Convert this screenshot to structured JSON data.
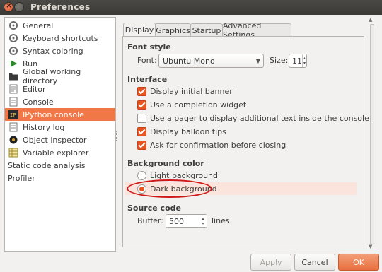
{
  "window": {
    "title": "Preferences"
  },
  "sidebar": {
    "items": [
      {
        "label": "General",
        "icon": "wrench-icon"
      },
      {
        "label": "Keyboard shortcuts",
        "icon": "keyboard-shortcuts-icon"
      },
      {
        "label": "Syntax coloring",
        "icon": "syntax-coloring-icon"
      },
      {
        "label": "Run",
        "icon": "run-icon"
      },
      {
        "label": "Global working directory",
        "icon": "folder-icon"
      },
      {
        "label": "Editor",
        "icon": "editor-icon"
      },
      {
        "label": "Console",
        "icon": "console-icon"
      },
      {
        "label": "IPython console",
        "icon": "ipython-icon",
        "selected": true
      },
      {
        "label": "History log",
        "icon": "history-icon"
      },
      {
        "label": "Object inspector",
        "icon": "object-inspector-icon"
      },
      {
        "label": "Variable explorer",
        "icon": "variable-explorer-icon"
      },
      {
        "label": "Static code analysis",
        "icon": ""
      },
      {
        "label": "Profiler",
        "icon": ""
      }
    ]
  },
  "tabs": [
    "Display",
    "Graphics",
    "Startup",
    "Advanced Settings"
  ],
  "font_style": {
    "heading": "Font style",
    "font_label": "Font:",
    "font_value": "Ubuntu Mono",
    "size_label": "Size:",
    "size_value": "11"
  },
  "interface": {
    "heading": "Interface",
    "options": [
      {
        "label": "Display initial banner",
        "checked": true
      },
      {
        "label": "Use a completion widget",
        "checked": true
      },
      {
        "label": "Use a pager to display additional text inside the console",
        "checked": false
      },
      {
        "label": "Display balloon tips",
        "checked": true
      },
      {
        "label": "Ask for confirmation before closing",
        "checked": true
      }
    ]
  },
  "background_color": {
    "heading": "Background color",
    "options": [
      {
        "label": "Light background",
        "checked": false
      },
      {
        "label": "Dark background",
        "checked": true
      }
    ]
  },
  "source_code": {
    "heading": "Source code",
    "buffer_label": "Buffer:",
    "buffer_value": "500",
    "buffer_unit": "lines"
  },
  "buttons": {
    "apply": "Apply",
    "cancel": "Cancel",
    "ok": "OK"
  },
  "colors": {
    "accent": "#e95420",
    "selection": "#f07746",
    "annotation": "#d01818"
  }
}
